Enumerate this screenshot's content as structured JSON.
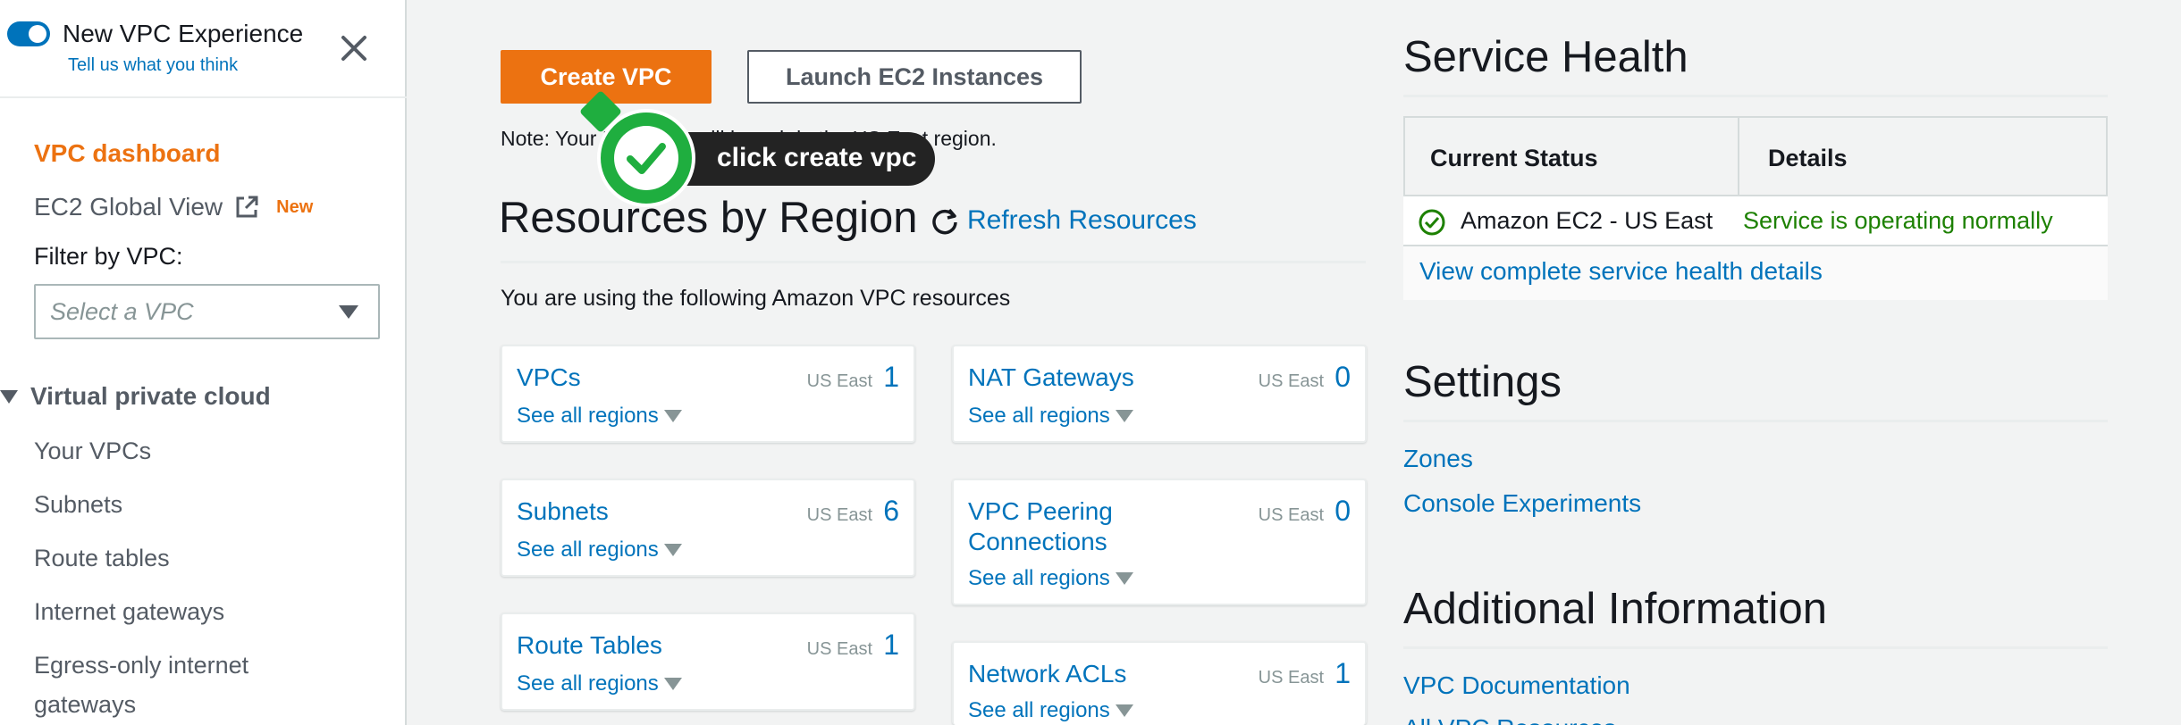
{
  "sidebar": {
    "toggle_title": "New VPC Experience",
    "toggle_link": "Tell us what you think",
    "active_item": "VPC dashboard",
    "ec2_global_view": "EC2 Global View",
    "new_badge": "New",
    "filter_label": "Filter by VPC:",
    "select_placeholder": "Select a VPC",
    "section_title": "Virtual private cloud",
    "items": [
      "Your VPCs",
      "Subnets",
      "Route tables",
      "Internet gateways",
      "Egress-only internet",
      "gateways"
    ]
  },
  "main": {
    "create_button": "Create VPC",
    "launch_button": "Launch EC2 Instances",
    "note": "Note: Your Instances will launch in the US East region.",
    "overlay_label": "click create vpc",
    "heading": "Resources by Region",
    "refresh": "Refresh Resources",
    "using_text": "You are using the following Amazon VPC resources",
    "cards": [
      {
        "name": "VPCs",
        "region": "US East",
        "count": "1",
        "see": "See all regions"
      },
      {
        "name": "NAT Gateways",
        "region": "US East",
        "count": "0",
        "see": "See all regions"
      },
      {
        "name": "Subnets",
        "region": "US East",
        "count": "6",
        "see": "See all regions"
      },
      {
        "name": "VPC Peering Connections",
        "region": "US East",
        "count": "0",
        "see": "See all regions"
      },
      {
        "name": "Route Tables",
        "region": "US East",
        "count": "1",
        "see": "See all regions"
      },
      {
        "name": "Network ACLs",
        "region": "US East",
        "count": "1",
        "see": "See all regions"
      }
    ]
  },
  "right": {
    "service_health_title": "Service Health",
    "col_status": "Current Status",
    "col_details": "Details",
    "service_name": "Amazon EC2 - US East",
    "service_status": "Service is operating normally",
    "health_link": "View complete service health details",
    "settings_title": "Settings",
    "zones_link": "Zones",
    "experiments_link": "Console Experiments",
    "additional_title": "Additional Information",
    "doc_link": "VPC Documentation",
    "all_link": "All VPC Resources"
  },
  "colors": {
    "accent": "#ec7211",
    "link": "#0073bb",
    "ok": "#1d8102",
    "overlay_green": "#1fae3f"
  }
}
